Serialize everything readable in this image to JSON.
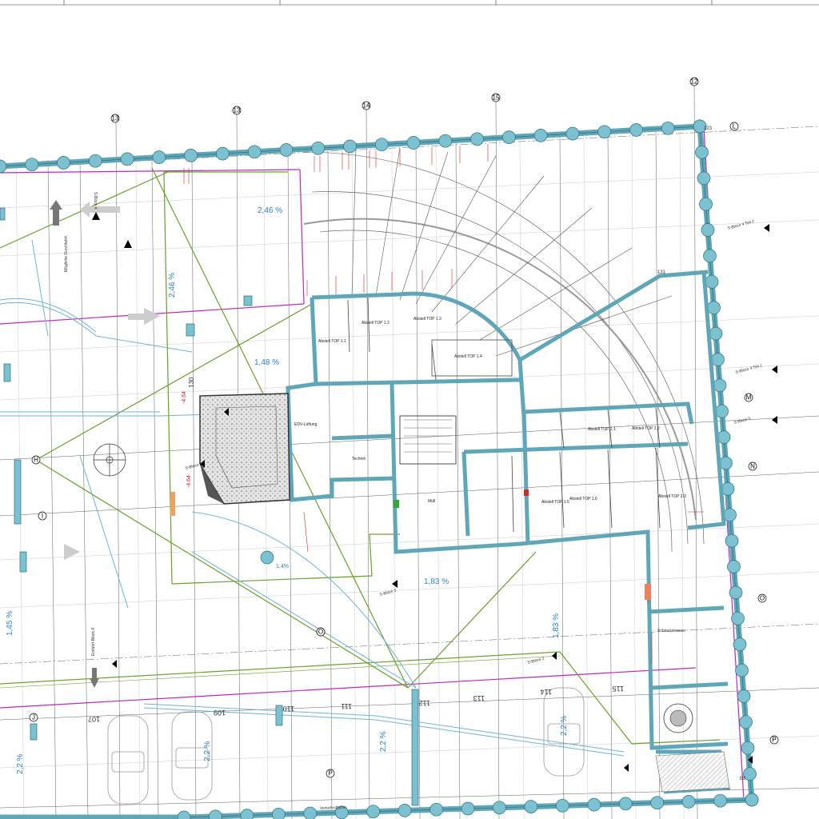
{
  "colors": {
    "wall_fill": "#5fa7b8",
    "wall_stroke": "#2d6d7d",
    "pile": "#7cc1d0",
    "magenta": "#c026c0",
    "green": "#6a9f2a",
    "blue_pipe": "#6db3d8",
    "slope_blue": "#2e86c1",
    "dim_red": "#d62728",
    "hatch_grey": "#888888"
  },
  "grid_axes": {
    "top": [
      "13",
      "13",
      "14",
      "15",
      "12"
    ],
    "right": [
      "L",
      "M",
      "N",
      "O",
      "P",
      "Q"
    ],
    "left": [
      "H",
      "I",
      "J"
    ],
    "inner": [
      "O"
    ]
  },
  "slopes": [
    "2,46 %",
    "2,46 %",
    "1,48 %",
    "1,83 %",
    "1,83 %",
    "1,45 %",
    "2,2 %",
    "2,2 %",
    "2,2 %",
    "2,2 %",
    "1,4%"
  ],
  "parking": [
    "107",
    "109",
    "110",
    "111",
    "112",
    "113",
    "114",
    "115"
  ],
  "rooms": [
    "Abstell TOP 1.1",
    "Abstell TOP 1.2",
    "Abstell TOP 1.3",
    "Abstell TOP 1.4",
    "Abstell TOP 2.1",
    "Abstell TOP 2.2",
    "Abstell TOP 2.3",
    "Abstell TOP 1.5",
    "Abstell TOP 1.6",
    "EDV-Lüftung",
    "Technik",
    "Müll"
  ],
  "sections": [
    "S-Block 4",
    "S-Block 3",
    "S-Block 2",
    "S-Block 1",
    "S-Block 4 Teil 2",
    "S-Block 4 Teil 1",
    "S-Block 5"
  ],
  "notes": [
    "Mögliche Durchfahrt",
    "Einfahrt Block 4",
    "Schmutzwasser",
    "Verkehrsfläche"
  ],
  "values": [
    "-4.64",
    "-4.64",
    "130",
    "123",
    "131",
    "E8"
  ]
}
